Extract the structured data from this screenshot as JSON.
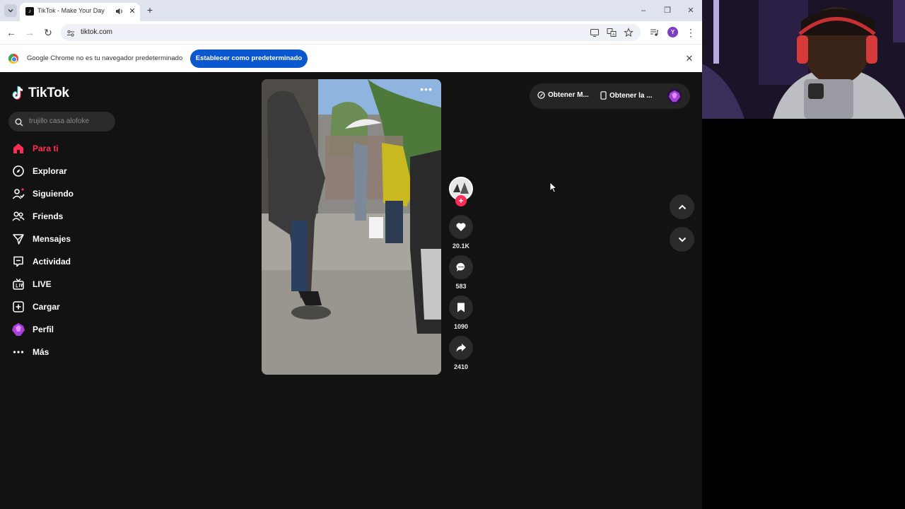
{
  "browser": {
    "tab_title": "TikTok - Make Your Day",
    "url": "tiktok.com",
    "profile_initial": "Y",
    "infobar_text": "Google Chrome no es tu navegador predeterminado",
    "default_button": "Establecer como predeterminado"
  },
  "tiktok": {
    "logo": "TikTok",
    "search_placeholder": "trujillo casa alofoke",
    "nav": [
      {
        "label": "Para ti",
        "icon": "home-icon",
        "active": true
      },
      {
        "label": "Explorar",
        "icon": "compass-icon"
      },
      {
        "label": "Siguiendo",
        "icon": "following-icon"
      },
      {
        "label": "Friends",
        "icon": "friends-icon"
      },
      {
        "label": "Mensajes",
        "icon": "messages-icon"
      },
      {
        "label": "Actividad",
        "icon": "activity-icon"
      },
      {
        "label": "LIVE",
        "icon": "live-icon"
      },
      {
        "label": "Cargar",
        "icon": "upload-icon"
      },
      {
        "label": "Perfil",
        "icon": "profile-avatar-icon"
      },
      {
        "label": "Más",
        "icon": "more-icon"
      }
    ],
    "actions": {
      "likes": "20.1K",
      "comments": "583",
      "saves": "1090",
      "shares": "2410"
    },
    "topbar": {
      "get_coins": "Obtener M...",
      "get_app": "Obtener la ..."
    }
  },
  "colors": {
    "accent": "#fe2c55",
    "page_bg": "#121212",
    "chrome_button": "#0b57d0"
  }
}
